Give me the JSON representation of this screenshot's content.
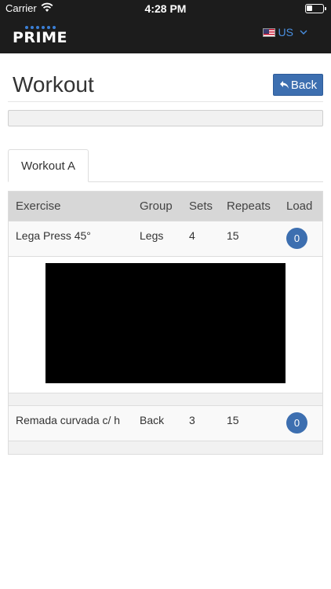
{
  "status_bar": {
    "carrier": "Carrier",
    "time": "4:28 PM"
  },
  "nav": {
    "logo_text": "PRIME",
    "language": {
      "label": "US",
      "flag_icon": "us-flag-icon",
      "chevron_icon": "chevron-down-icon"
    }
  },
  "header": {
    "title": "Workout",
    "back_label": "Back",
    "back_icon": "reply-arrow-icon"
  },
  "tabs": [
    {
      "label": "Workout A",
      "active": true
    }
  ],
  "table": {
    "columns": [
      "Exercise",
      "Group",
      "Sets",
      "Repeats",
      "Load"
    ],
    "rows": [
      {
        "exercise": "Lega Press 45°",
        "group": "Legs",
        "sets": "4",
        "repeats": "15",
        "load": "0",
        "has_video": true
      },
      {
        "exercise": "Remada curvada c/ h",
        "group": "Back",
        "sets": "3",
        "repeats": "15",
        "load": "0",
        "has_video": false
      }
    ]
  },
  "colors": {
    "nav_background": "#1c1c1c",
    "accent_blue": "#3d6fb0",
    "link_blue": "#4a90e2",
    "table_header": "#d7d7d7"
  }
}
